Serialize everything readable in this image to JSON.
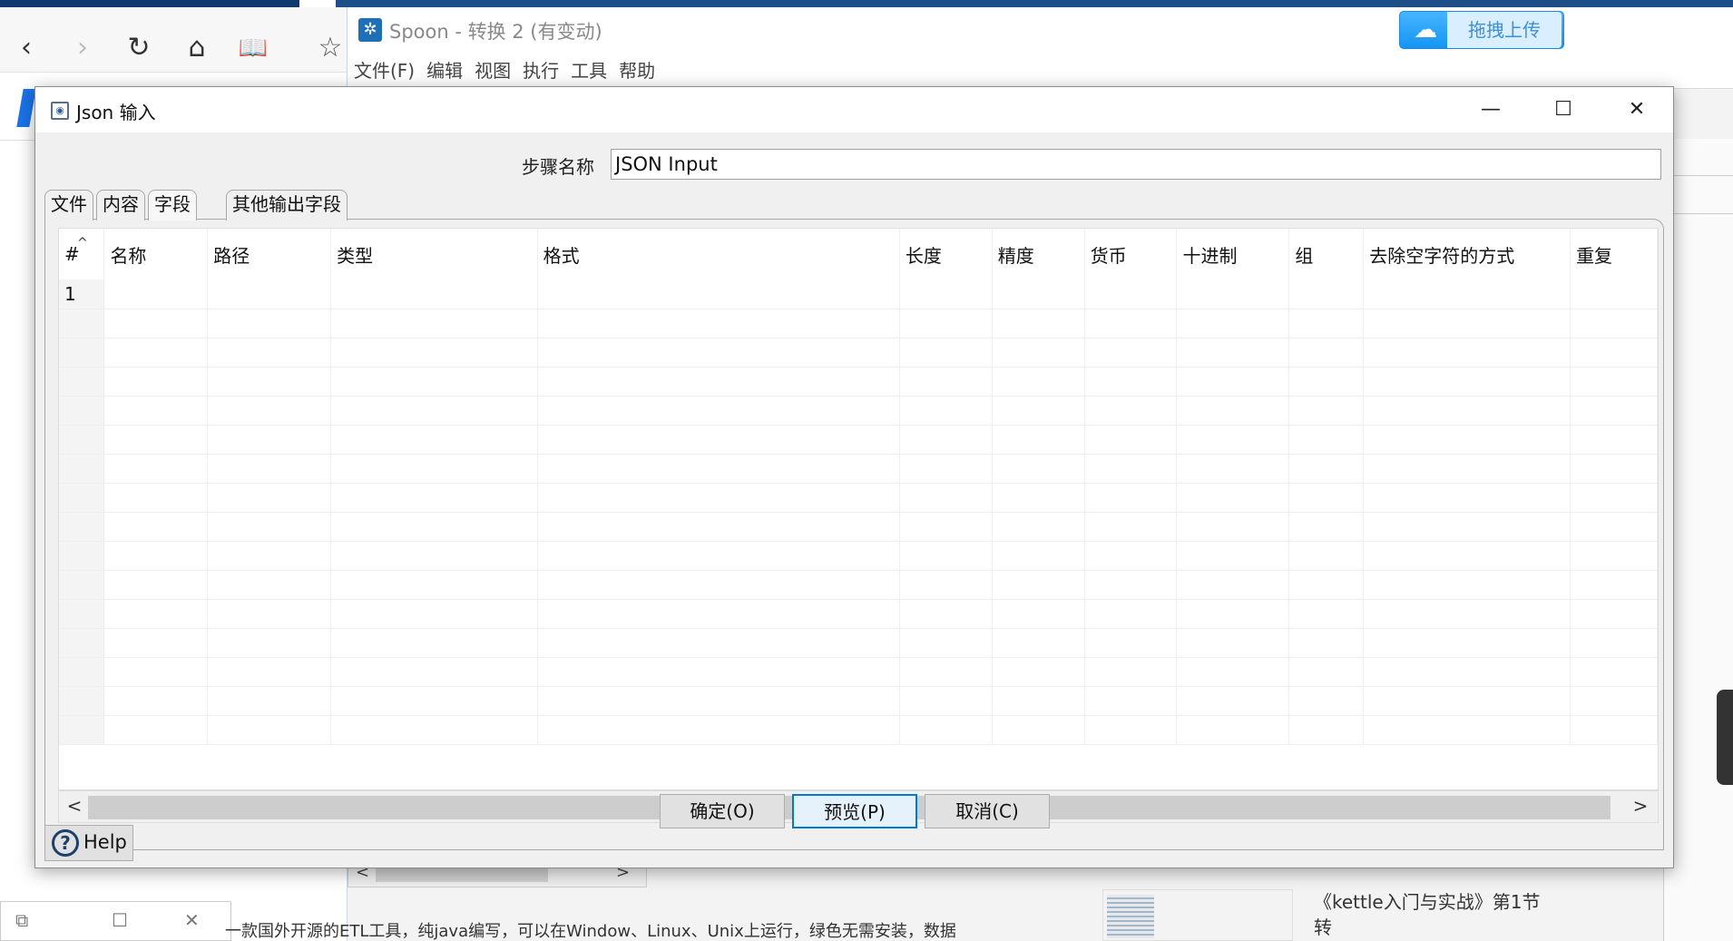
{
  "browser": {
    "nav": {
      "back": "‹",
      "forward": "›",
      "reload": "↻",
      "home": "⌂",
      "reading": "📖",
      "favorite": "☆"
    },
    "upload_label": "拖拽上传"
  },
  "spoon": {
    "title": "Spoon - 转换 2 (有变动)",
    "menu": [
      "文件(F)",
      "编辑",
      "视图",
      "执行",
      "工具",
      "帮助"
    ]
  },
  "dialog": {
    "title": "Json 输入",
    "window_buttons": {
      "minimize": "—",
      "maximize": "☐",
      "close": "✕"
    },
    "step_name_label": "步骤名称",
    "step_name_value": "JSON Input",
    "tabs": [
      "文件",
      "内容",
      "字段",
      "其他输出字段"
    ],
    "active_tab": "字段",
    "grid": {
      "columns": [
        "#",
        "名称",
        "路径",
        "类型",
        "格式",
        "长度",
        "精度",
        "货币",
        "十进制",
        "组",
        "去除空字符的方式",
        "重复"
      ],
      "rows": [
        [
          "1",
          "",
          "",
          "",
          "",
          "",
          "",
          "",
          "",
          "",
          "",
          ""
        ]
      ],
      "sort_indicator": "^"
    },
    "scroll": {
      "left": "<",
      "right": ">"
    },
    "buttons": {
      "ok": "确定(O)",
      "preview": "预览(P)",
      "cancel": "取消(C)"
    },
    "help_label": "Help",
    "help_icon": "?"
  },
  "background": {
    "article_snippet": "一款国外开源的ETL工具，纯java编写，可以在Window、Linux、Unix上运行，绿色无需安装，数据",
    "article_title_line1": "《kettle入门与实战》第1节",
    "article_title_line2": "转",
    "bottom_tile": {
      "restore": "⧉",
      "maximize": "☐",
      "close": "✕"
    },
    "scroll": {
      "left": "<",
      "right": ">"
    }
  },
  "colors": {
    "accent": "#0078d7",
    "titlebar_dark": "#1e4e87",
    "upload_blue": "#1596f2"
  }
}
